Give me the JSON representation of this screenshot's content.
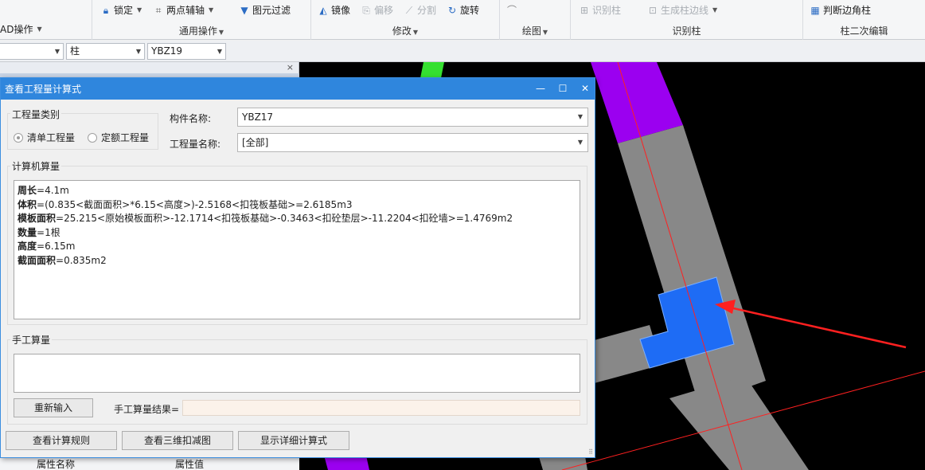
{
  "ribbon": {
    "cad_ops": {
      "label": "AD操作"
    },
    "general": {
      "lock_label": "锁定",
      "axis_label": "两点辅轴",
      "filter_label": "图元过滤",
      "caption": "通用操作"
    },
    "modify": {
      "mirror_label": "镜像",
      "offset_label": "偏移",
      "split_label": "分割",
      "rotate_label": "旋转",
      "caption": "修改"
    },
    "draw": {
      "caption": "绘图"
    },
    "identify": {
      "identify_col_label": "识别柱",
      "gen_edge_label": "生成柱边线",
      "caption": "识别柱"
    },
    "secondary": {
      "judge_corner_label": "判断边角柱",
      "caption": "柱二次编辑"
    }
  },
  "selectors": {
    "first_value": "",
    "type_value": "柱",
    "name_value": "YBZ19"
  },
  "left_panel": {
    "close_glyph": "×",
    "prop_col_name": "属性名称",
    "prop_col_value": "属性值"
  },
  "dialog": {
    "title": "查看工程量计算式",
    "qty_type_group": "工程量类别",
    "radio_bill": "清单工程量",
    "radio_quota": "定额工程量",
    "member_name_label": "构件名称:",
    "member_name_value": "YBZ17",
    "qty_name_label": "工程量名称:",
    "qty_name_value": "[全部]",
    "computer_group": "计算机算量",
    "calc_lines": [
      {
        "key": "周长",
        "expr": "=4.1m"
      },
      {
        "key": "体积",
        "expr": "=(0.835<截面面积>*6.15<高度>)-2.5168<扣筏板基础>=2.6185m3"
      },
      {
        "key": "模板面积",
        "expr": "=25.215<原始模板面积>-12.1714<扣筏板基础>-0.3463<扣砼垫层>-11.2204<扣砼墙>=1.4769m2"
      },
      {
        "key": "数量",
        "expr": "=1根"
      },
      {
        "key": "高度",
        "expr": "=6.15m"
      },
      {
        "key": "截面面积",
        "expr": "=0.835m2"
      }
    ],
    "manual_group": "手工算量",
    "reinput_button": "重新输入",
    "manual_result_label": "手工算量结果=",
    "manual_result_value": "",
    "btn_rules": "查看计算规则",
    "btn_3d": "查看三维扣减图",
    "btn_detail": "显示详细计算式"
  },
  "colors": {
    "titlebar": "#2f86dd",
    "column_selected": "#1e6cf5",
    "axis_line": "#ff2020",
    "purple_member": "#9b00f0",
    "green_member": "#35e030"
  }
}
